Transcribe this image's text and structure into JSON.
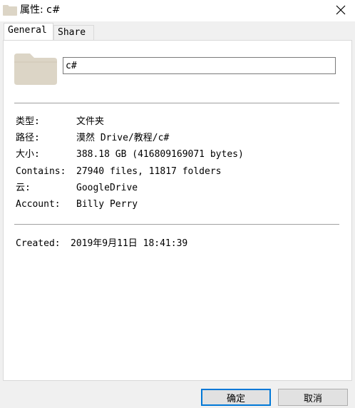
{
  "window": {
    "title": "属性: c#",
    "close_icon": "close-icon"
  },
  "tabs": [
    {
      "label": "General",
      "active": true
    },
    {
      "label": "Share",
      "active": false
    }
  ],
  "general": {
    "folder_icon": "folder-icon",
    "name_value": "c#",
    "details": [
      {
        "label": "类型:",
        "value": "文件夹"
      },
      {
        "label": "路径:",
        "value": "漠然 Drive/教程/c#"
      },
      {
        "label": "大小:",
        "value": "388.18 GB (416809169071 bytes)"
      },
      {
        "label": "Contains:",
        "value": "27940 files, 11817 folders"
      },
      {
        "label": "云:",
        "value": "GoogleDrive"
      },
      {
        "label": "Account:",
        "value": "Billy Perry"
      }
    ],
    "created": {
      "label": "Created:",
      "value": "2019年9月11日 18:41:39"
    }
  },
  "buttons": {
    "ok_label": "确定",
    "cancel_label": "取消"
  },
  "colors": {
    "folder": "#dcd5c6",
    "accent": "#0078d7"
  }
}
